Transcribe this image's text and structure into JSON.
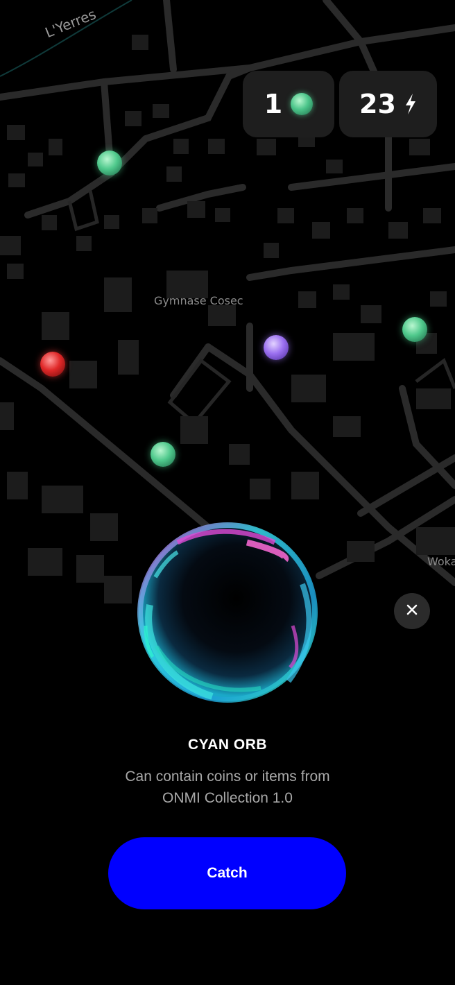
{
  "map": {
    "labels": {
      "river": "L'Yerres",
      "gymnasium": "Gymnase Cosec",
      "partial": "Woka"
    }
  },
  "stats": {
    "orbs_count": "1",
    "energy_count": "23",
    "orb_icon": "green-orb-icon",
    "energy_icon": "lightning-bolt-icon"
  },
  "orb_colors": {
    "green": "#4fc98c",
    "purple": "#9b70f0",
    "red": "#e02828",
    "cyan": "#27e3e0",
    "magenta": "#d94ad6"
  },
  "detail": {
    "title": "CYAN ORB",
    "description_line1": "Can contain coins or items from",
    "description_line2": "ONMI Collection 1.0",
    "close_icon": "close-icon"
  },
  "actions": {
    "catch_label": "Catch",
    "catch_color": "#0000ff"
  }
}
